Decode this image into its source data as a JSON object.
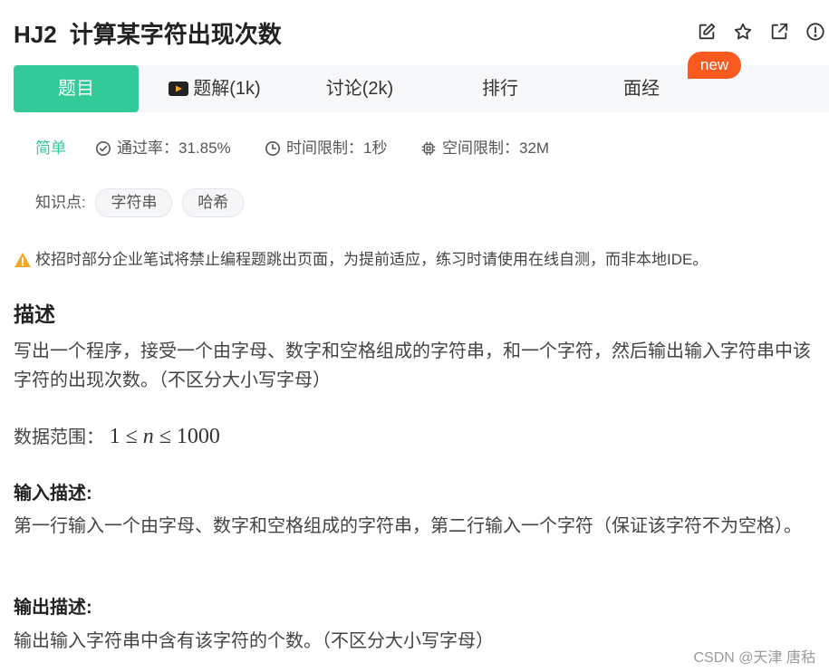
{
  "problem": {
    "id": "HJ2",
    "title": "计算某字符出现次数"
  },
  "top_icons": [
    "edit-icon",
    "star-icon",
    "share-icon",
    "info-icon"
  ],
  "tabs": [
    {
      "label": "题目",
      "active": true
    },
    {
      "label": "题解(1k)",
      "icon": "video-icon"
    },
    {
      "label": "讨论(2k)"
    },
    {
      "label": "排行"
    },
    {
      "label": "面经"
    }
  ],
  "new_badge": "new",
  "meta": {
    "difficulty": "简单",
    "pass_rate": "通过率：31.85%",
    "time_limit": "时间限制：1秒",
    "space_limit": "空间限制：32M"
  },
  "knowledge": {
    "label": "知识点:",
    "tags": [
      "字符串",
      "哈希"
    ]
  },
  "notice": "校招时部分企业笔试将禁止编程题跳出页面，为提前适应，练习时请使用在线自测，而非本地IDE。",
  "description": {
    "heading": "描述",
    "text": "写出一个程序，接受一个由字母、数字和空格组成的字符串，和一个字符，然后输出输入字符串中该字符的出现次数。（不区分大小写字母）",
    "range_label": "数据范围：",
    "range_math": {
      "low": "1",
      "var": "n",
      "high": "1000"
    }
  },
  "input_desc": {
    "heading": "输入描述:",
    "text": "第一行输入一个由字母、数字和空格组成的字符串，第二行输入一个字符（保证该字符不为空格）。"
  },
  "output_desc": {
    "heading": "输出描述:",
    "text": "输出输入字符串中含有该字符的个数。（不区分大小写字母）"
  },
  "watermark": "CSDN @天津 唐秙",
  "colors": {
    "accent": "#32ca99",
    "badge": "#fa5a1e",
    "warning": "#f5a623"
  }
}
